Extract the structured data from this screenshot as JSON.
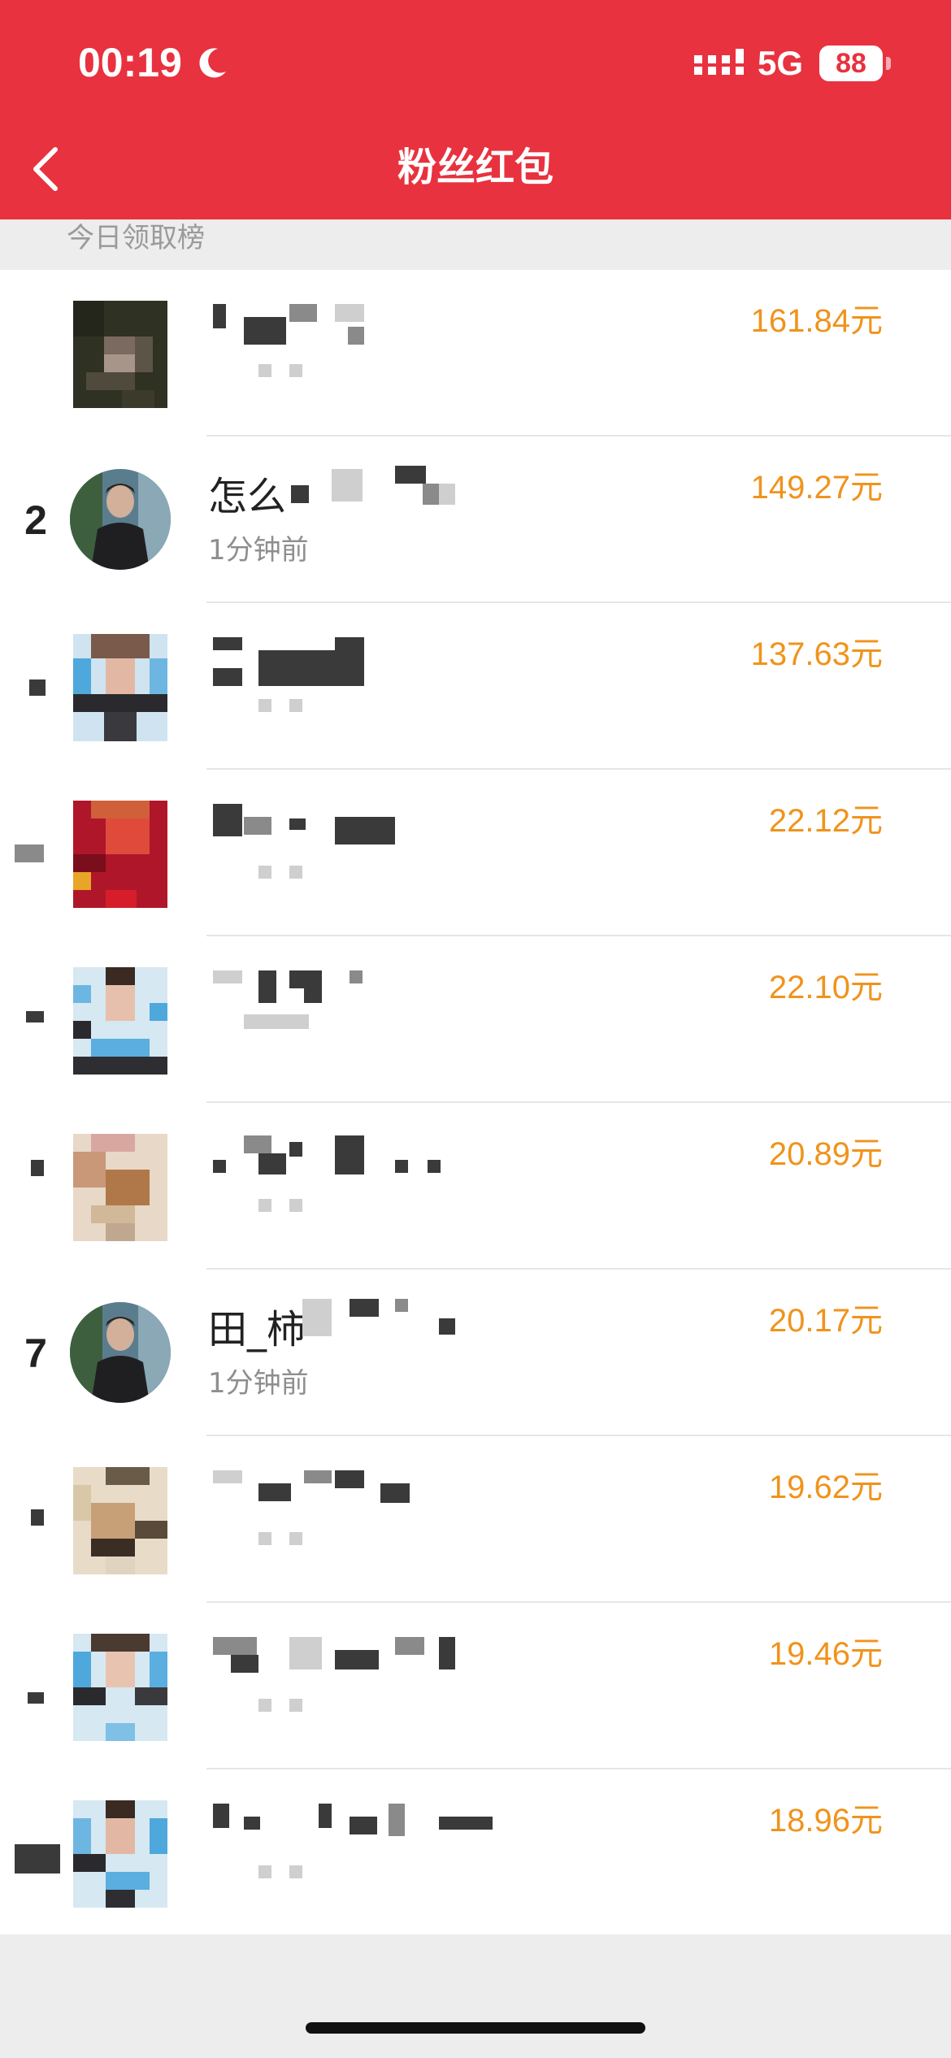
{
  "status_bar": {
    "time": "00:19",
    "network": "5G",
    "battery": "88",
    "icons": [
      "moon-icon",
      "signal-icon"
    ]
  },
  "header": {
    "title": "粉丝红包",
    "back_icon": "chevron-left-icon",
    "color": "#e8323f"
  },
  "section": {
    "label": "今日领取榜"
  },
  "amount_color": "#f0931c",
  "rows": [
    {
      "rank": "",
      "name": "",
      "time": "",
      "amount": "161.84元"
    },
    {
      "rank": "2",
      "name": "怎么",
      "time": "1分钟前",
      "amount": "149.27元"
    },
    {
      "rank": "",
      "name": "",
      "time": "",
      "amount": "137.63元"
    },
    {
      "rank": "",
      "name": "",
      "time": "",
      "amount": "22.12元"
    },
    {
      "rank": "",
      "name": "",
      "time": "",
      "amount": "22.10元"
    },
    {
      "rank": "",
      "name": "",
      "time": "",
      "amount": "20.89元"
    },
    {
      "rank": "7",
      "name": "田_柿",
      "time": "1分钟前",
      "amount": "20.17元"
    },
    {
      "rank": "",
      "name": "",
      "time": "",
      "amount": "19.62元"
    },
    {
      "rank": "",
      "name": "",
      "time": "",
      "amount": "19.46元"
    },
    {
      "rank": "",
      "name": "",
      "time": "",
      "amount": "18.96元"
    }
  ]
}
